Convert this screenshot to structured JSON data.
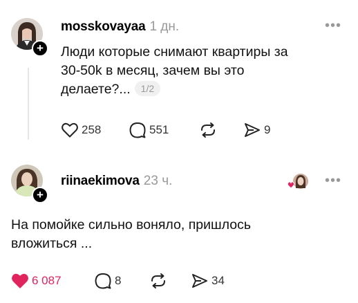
{
  "posts": [
    {
      "username": "mosskovayaa",
      "time": "1 дн.",
      "more": "•••",
      "text_line1": "Люди которые снимают квартиры за",
      "text_line2": "30-50k в месяц, зачем вы это",
      "text_line3": "делаете?...",
      "page_counter": "1/2",
      "likes": "258",
      "comments": "551",
      "shares": "9",
      "liked": false
    },
    {
      "username": "riinaekimova",
      "time": "23 ч.",
      "more": "•••",
      "text_line1": "На помойке сильно воняло, пришлось",
      "text_line2": "вложиться ...",
      "likes": "6 087",
      "comments": "8",
      "shares": "34",
      "liked": true
    }
  ],
  "colors": {
    "like_active": "#e0245e",
    "muted": "#999999",
    "thread_line": "#e5e5e5"
  }
}
